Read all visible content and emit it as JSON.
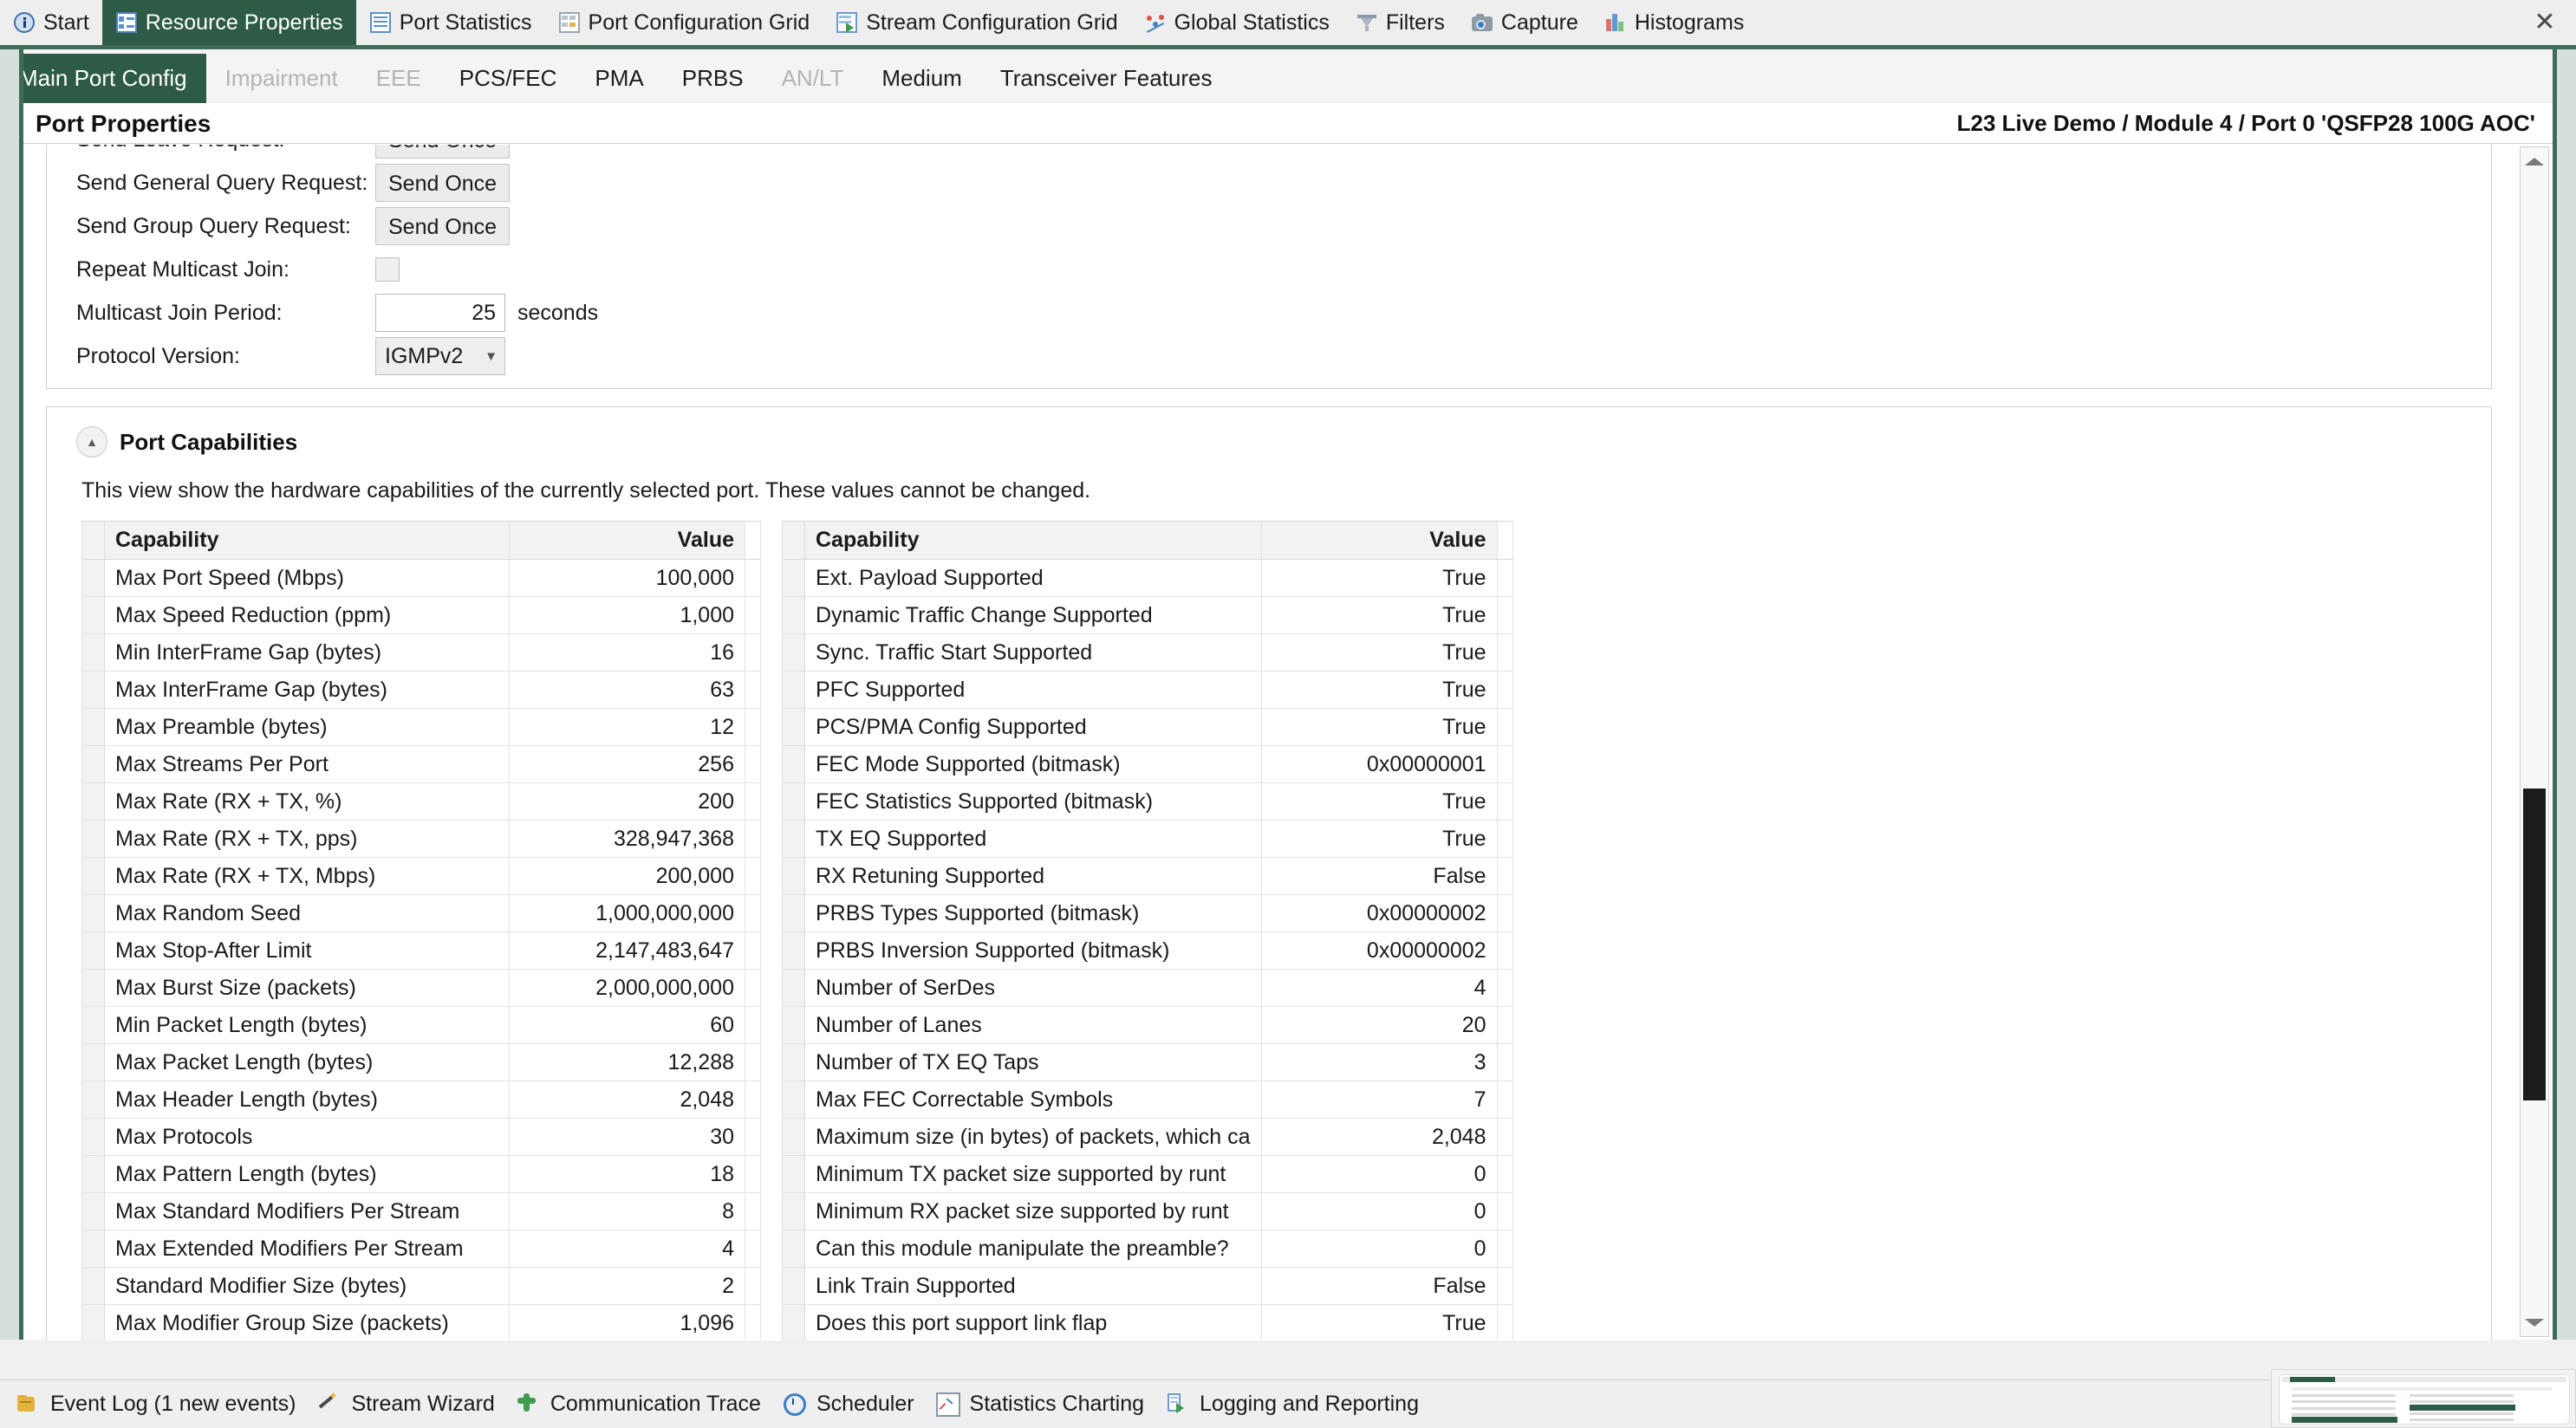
{
  "window": {
    "close_label": "✕"
  },
  "view_tabs": [
    {
      "label": "Start",
      "icon": "info-icon",
      "active": false
    },
    {
      "label": "Resource Properties",
      "icon": "properties-icon",
      "active": true
    },
    {
      "label": "Port Statistics",
      "icon": "list-icon",
      "active": false
    },
    {
      "label": "Port Configuration Grid",
      "icon": "grid-icon",
      "active": false
    },
    {
      "label": "Stream Configuration Grid",
      "icon": "stream-grid-icon",
      "active": false
    },
    {
      "label": "Global Statistics",
      "icon": "scatter-chart-icon",
      "active": false
    },
    {
      "label": "Filters",
      "icon": "funnel-icon",
      "active": false
    },
    {
      "label": "Capture",
      "icon": "camera-icon",
      "active": false
    },
    {
      "label": "Histograms",
      "icon": "bar-chart-icon",
      "active": false
    }
  ],
  "page_tabs": [
    {
      "label": "Main Port Config",
      "state": "active"
    },
    {
      "label": "Impairment",
      "state": "disabled"
    },
    {
      "label": "EEE",
      "state": "disabled"
    },
    {
      "label": "PCS/FEC",
      "state": "normal"
    },
    {
      "label": "PMA",
      "state": "normal"
    },
    {
      "label": "PRBS",
      "state": "normal"
    },
    {
      "label": "AN/LT",
      "state": "disabled"
    },
    {
      "label": "Medium",
      "state": "normal"
    },
    {
      "label": "Transceiver Features",
      "state": "normal"
    }
  ],
  "pane": {
    "title": "Port Properties",
    "breadcrumb": "L23 Live Demo / Module 4 / Port 0 'QSFP28 100G AOC'"
  },
  "igmp_form": {
    "rows": [
      {
        "label": "Send Leave Request:",
        "control": "button",
        "value": "Send Once"
      },
      {
        "label": "Send General Query Request:",
        "control": "button",
        "value": "Send Once"
      },
      {
        "label": "Send Group Query Request:",
        "control": "button",
        "value": "Send Once"
      },
      {
        "label": "Repeat Multicast Join:",
        "control": "checkbox",
        "value": "",
        "checked": false
      },
      {
        "label": "Multicast Join Period:",
        "control": "number",
        "value": "25",
        "unit": "seconds"
      },
      {
        "label": "Protocol Version:",
        "control": "select",
        "value": "IGMPv2"
      }
    ]
  },
  "capabilities": {
    "section_title": "Port Capabilities",
    "description": "This view show the hardware capabilities of the currently selected port. These values cannot be changed.",
    "collapse_glyph": "▲",
    "headers": {
      "name": "Capability",
      "value": "Value"
    },
    "left_rows": [
      {
        "name": "Max Port Speed (Mbps)",
        "value": "100,000"
      },
      {
        "name": "Max Speed Reduction (ppm)",
        "value": "1,000"
      },
      {
        "name": "Min InterFrame Gap (bytes)",
        "value": "16"
      },
      {
        "name": "Max InterFrame Gap (bytes)",
        "value": "63"
      },
      {
        "name": "Max Preamble (bytes)",
        "value": "12"
      },
      {
        "name": "Max Streams Per Port",
        "value": "256"
      },
      {
        "name": "Max Rate (RX + TX, %)",
        "value": "200"
      },
      {
        "name": "Max Rate (RX + TX, pps)",
        "value": "328,947,368"
      },
      {
        "name": "Max Rate (RX + TX, Mbps)",
        "value": "200,000"
      },
      {
        "name": "Max Random Seed",
        "value": "1,000,000,000"
      },
      {
        "name": "Max Stop-After Limit",
        "value": "2,147,483,647"
      },
      {
        "name": "Max Burst Size (packets)",
        "value": "2,000,000,000"
      },
      {
        "name": "Min Packet Length (bytes)",
        "value": "60"
      },
      {
        "name": "Max Packet Length (bytes)",
        "value": "12,288"
      },
      {
        "name": "Max Header Length (bytes)",
        "value": "2,048"
      },
      {
        "name": "Max Protocols",
        "value": "30"
      },
      {
        "name": "Max Pattern Length (bytes)",
        "value": "18"
      },
      {
        "name": "Max Standard Modifiers Per Stream",
        "value": "8"
      },
      {
        "name": "Max Extended Modifiers Per Stream",
        "value": "4"
      },
      {
        "name": "Standard Modifier Size (bytes)",
        "value": "2"
      },
      {
        "name": "Max Modifier Group Size (packets)",
        "value": "1,096"
      }
    ],
    "right_rows": [
      {
        "name": "Ext. Payload Supported",
        "value": "True"
      },
      {
        "name": "Dynamic Traffic Change Supported",
        "value": "True"
      },
      {
        "name": "Sync. Traffic Start Supported",
        "value": "True"
      },
      {
        "name": "PFC Supported",
        "value": "True"
      },
      {
        "name": "PCS/PMA Config Supported",
        "value": "True"
      },
      {
        "name": "FEC Mode Supported (bitmask)",
        "value": "0x00000001"
      },
      {
        "name": "FEC Statistics Supported (bitmask)",
        "value": "True"
      },
      {
        "name": "TX EQ Supported",
        "value": "True"
      },
      {
        "name": "RX Retuning Supported",
        "value": "False"
      },
      {
        "name": "PRBS Types Supported (bitmask)",
        "value": "0x00000002"
      },
      {
        "name": "PRBS Inversion Supported (bitmask)",
        "value": "0x00000002"
      },
      {
        "name": "Number of SerDes",
        "value": "4"
      },
      {
        "name": "Number of Lanes",
        "value": "20"
      },
      {
        "name": "Number of TX EQ Taps",
        "value": "3"
      },
      {
        "name": "Max FEC Correctable Symbols",
        "value": "7"
      },
      {
        "name": "Maximum size (in bytes) of packets, which ca",
        "value": "2,048"
      },
      {
        "name": "Minimum TX packet size supported by runt",
        "value": "0"
      },
      {
        "name": "Minimum RX packet size supported by runt",
        "value": "0"
      },
      {
        "name": "Can this module manipulate the preamble?",
        "value": "0"
      },
      {
        "name": "Link Train Supported",
        "value": "False"
      },
      {
        "name": "Does this port support link flap",
        "value": "True"
      }
    ]
  },
  "status_bar": [
    {
      "label": "Event Log (1 new events)",
      "icon": "event-log-icon"
    },
    {
      "label": "Stream Wizard",
      "icon": "wand-icon"
    },
    {
      "label": "Communication Trace",
      "icon": "trace-icon"
    },
    {
      "label": "Scheduler",
      "icon": "clock-icon"
    },
    {
      "label": "Statistics Charting",
      "icon": "chart-icon"
    },
    {
      "label": "Logging and Reporting",
      "icon": "report-icon"
    }
  ],
  "colors": {
    "accent_green": "#2e5b46",
    "rail_green": "#3f6b58",
    "pane_bg": "#ffffff",
    "chrome_bg": "#efefef"
  }
}
